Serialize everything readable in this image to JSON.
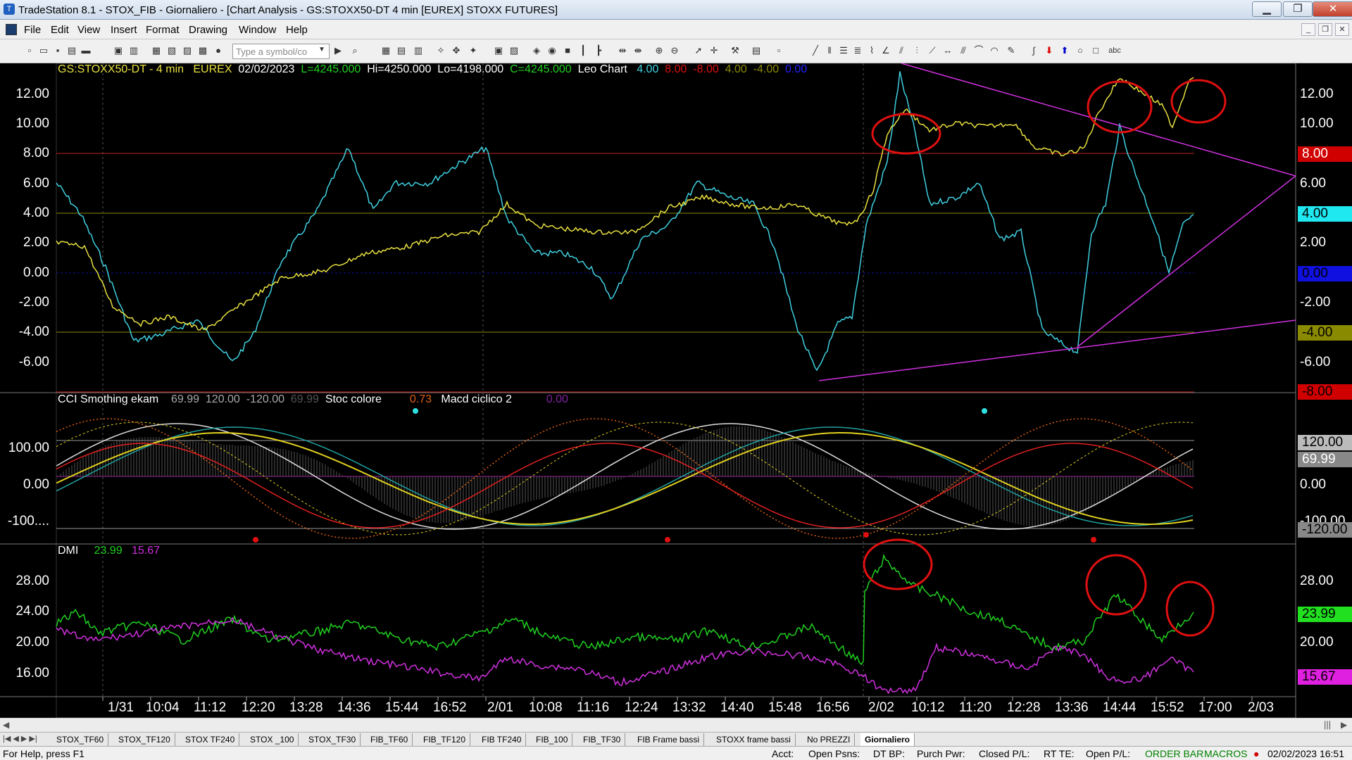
{
  "window": {
    "title": "TradeStation 8.1 - STOX_FIB - Giornaliero - [Chart Analysis - GS:STOXX50-DT  4 min  [EUREX] STOXX FUTURES]",
    "minimize": "▁",
    "restore": "❐",
    "close": "✕"
  },
  "menu": [
    "File",
    "Edit",
    "View",
    "Insert",
    "Format",
    "Drawing",
    "Window",
    "Help"
  ],
  "toolbar": {
    "symbol_placeholder": "Type a symbol/co"
  },
  "price_pane": {
    "symbol": "GS:STOXX50-DT - 4 min",
    "exchange": "EUREX",
    "date": "02/02/2023",
    "last": "L=4245.000",
    "high": "Hi=4250.000",
    "low": "Lo=4198.000",
    "close": "C=4245.000",
    "study": "Leo Chart",
    "v1": "4.00",
    "v2": "8.00",
    "v3": "-8.00",
    "v4": "4.00",
    "v5": "-4.00",
    "v6": "0.00",
    "y_ticks": [
      "12.00",
      "10.00",
      "8.00",
      "6.00",
      "4.00",
      "2.00",
      "0.00",
      "-2.00",
      "-4.00",
      "-6.00"
    ],
    "tags": [
      "8.00",
      "4.00",
      "0.00",
      "-4.00",
      "-8.00"
    ]
  },
  "cci_pane": {
    "title": "CCI Smothing ekam",
    "v1": "69.99",
    "v2": "120.00",
    "v3": "-120.00",
    "v4": "69.99",
    "stoc": "Stoc colore",
    "stoc_val": "0.73",
    "macd": "Macd ciclico 2",
    "macd_val": "0.00",
    "y_ticks_left": [
      "100.00",
      "0.00",
      "-100...."
    ],
    "y_ticks_right": [
      "0.00",
      "-100.00"
    ],
    "tags": [
      "120.00",
      "69.99",
      "-120.00"
    ]
  },
  "dmi_pane": {
    "title": "DMI",
    "plus": "23.99",
    "minus": "15.67",
    "y_ticks": [
      "28.00",
      "24.00",
      "20.00",
      "16.00"
    ],
    "tags": [
      "23.99",
      "15.67"
    ]
  },
  "x_axis": [
    "1/31",
    "10:04",
    "11:12",
    "12:20",
    "13:28",
    "14:36",
    "15:44",
    "16:52",
    "2/01",
    "10:08",
    "11:16",
    "12:24",
    "13:32",
    "14:40",
    "15:48",
    "16:56",
    "2/02",
    "10:12",
    "11:20",
    "12:28",
    "13:36",
    "14:44",
    "15:52",
    "17:00",
    "2/03"
  ],
  "tabs": [
    "STOX_TF60",
    "STOX_TF120",
    "STOX TF240",
    "STOX _100",
    "STOX_TF30",
    "FIB_TF60",
    "FIB_TF120",
    "FIB TF240",
    "FIB_100",
    "FIB_TF30",
    "FIB Frame bassi",
    "STOXX frame bassi",
    "No PREZZI",
    "Giornaliero"
  ],
  "status": {
    "help": "For Help, press F1",
    "acct": "Acct:",
    "open_psns": "Open Psns:",
    "dt_bp": "DT BP:",
    "purch_pwr": "Purch Pwr:",
    "closed_pl": "Closed P/L:",
    "rt_te": "RT TE:",
    "open_pl": "Open P/L:",
    "order_bar": "ORDER BAR",
    "macros": "MACROS",
    "datetime": "02/02/2023 16:51"
  },
  "colors": {
    "cyan": "#3fd0e0",
    "yellow": "#e8e040",
    "magenta": "#d030e0",
    "red": "#e01010",
    "green": "#20d020",
    "olive": "#8a8a00",
    "redline": "#c02020",
    "blue": "#2020ff"
  }
}
